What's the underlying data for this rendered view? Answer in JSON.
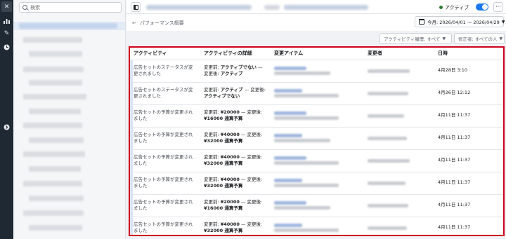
{
  "sidebar": {
    "search_placeholder": "検索"
  },
  "topbar": {
    "status_label": "アクティブ",
    "more": "···"
  },
  "header": {
    "back_label": "パフォーマンス概要",
    "date_range": "今月: 2026/04/01 ～ 2026/04/29"
  },
  "filters": {
    "activity_history": "アクティビティ履歴: すべて",
    "editor": "修正者: すべての人"
  },
  "table": {
    "columns": [
      "アクティビティ",
      "アクティビティの詳細",
      "変更アイテム",
      "変更者",
      "日時"
    ],
    "rows": [
      {
        "activity": "広告セットのステータスが変更されました",
        "before_label": "変更前: ",
        "before_value": "アクティブでない",
        "sep": " — ",
        "after_label": "変更後: ",
        "after_value": "アクティブ",
        "date": "4月28日 3:10"
      },
      {
        "activity": "広告セットのステータスが変更されました",
        "before_label": "変更前: ",
        "before_value": "アクティブ",
        "sep": " — ",
        "after_label": "変更後: ",
        "after_value": "アクティブでない",
        "date": "4月26日 12:12"
      },
      {
        "activity": "広告セットの予算が変更されました",
        "before_label": "変更前: ",
        "before_value": "¥20000",
        "sep": " — ",
        "after_label": "変更後: ",
        "after_value": "¥16000 通算予算",
        "date": "4月11日 11:37"
      },
      {
        "activity": "広告セットの予算が変更されました",
        "before_label": "変更前: ",
        "before_value": "¥40000",
        "sep": " — ",
        "after_label": "変更後: ",
        "after_value": "¥32000 通算予算",
        "date": "4月11日 11:37"
      },
      {
        "activity": "広告セットの予算が変更されました",
        "before_label": "変更前: ",
        "before_value": "¥40000",
        "sep": " — ",
        "after_label": "変更後: ",
        "after_value": "¥32000 通算予算",
        "date": "4月11日 11:37"
      },
      {
        "activity": "広告セットの予算が変更されました",
        "before_label": "変更前: ",
        "before_value": "¥40000",
        "sep": " — ",
        "after_label": "変更後: ",
        "after_value": "¥32000 通算予算",
        "date": "4月11日 11:37"
      },
      {
        "activity": "広告セットの予算が変更されました",
        "before_label": "変更前: ",
        "before_value": "¥20000",
        "sep": " — ",
        "after_label": "変更後: ",
        "after_value": "¥16000 通算予算",
        "date": "4月11日 11:37"
      },
      {
        "activity": "広告セットの予算が変更されました",
        "before_label": "変更前: ",
        "before_value": "¥40000",
        "sep": " — ",
        "after_label": "変更後: ",
        "after_value": "¥32000 通算予算",
        "date": "4月11日 11:37"
      }
    ]
  },
  "colors": {
    "rail": "#1f2933",
    "accent": "#1877f2",
    "highlight_border": "#d0011b",
    "status": "#2e7d32"
  }
}
